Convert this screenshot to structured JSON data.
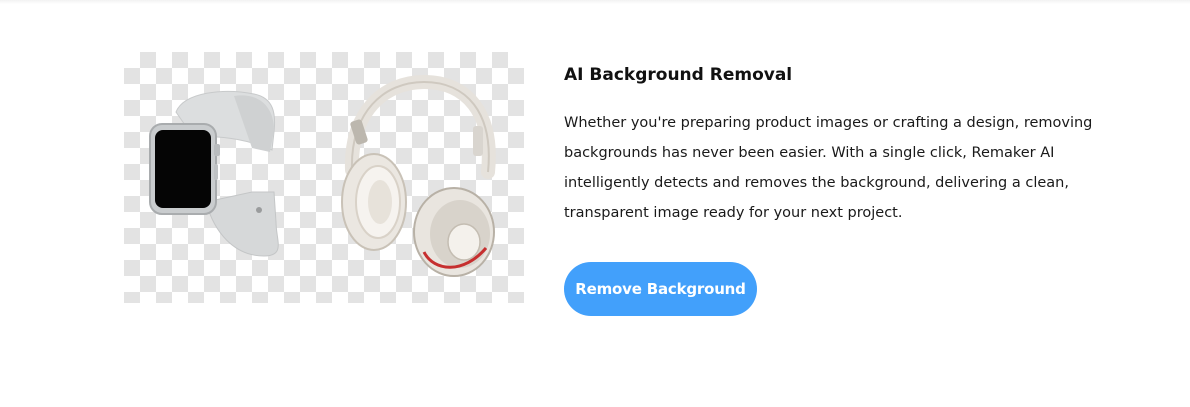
{
  "feature": {
    "title": "AI Background Removal",
    "description": "Whether you're preparing product images or crafting a design, removing backgrounds has never been easier. With a single click, Remaker AI intelligently detects and removes the background, delivering a clean, transparent image ready for your next project.",
    "button_label": "Remove Background"
  },
  "preview": {
    "icons": [
      "smartwatch-icon",
      "headphones-icon"
    ],
    "background": "transparency-checkerboard"
  },
  "colors": {
    "accent": "#42a0fb",
    "checker": "#e3e3e3"
  }
}
